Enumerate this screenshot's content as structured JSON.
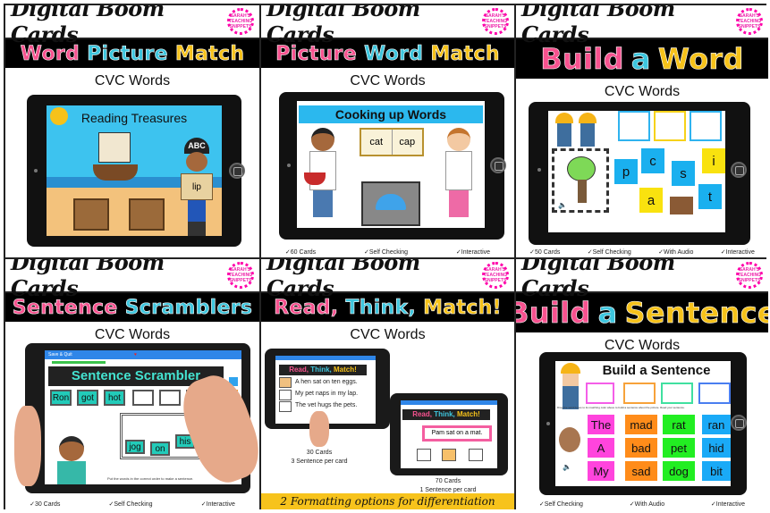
{
  "header_title": "Digital Boom Cards",
  "logo_text": "SARAH'S TEACHING SNIPPETS",
  "panels": [
    {
      "title_words": [
        {
          "text": "Word",
          "color": "pink"
        },
        {
          "text": "Picture",
          "color": "cyan"
        },
        {
          "text": "Match",
          "color": "yellow"
        }
      ],
      "subtitle": "CVC Words",
      "scene_title": "Reading Treasures",
      "scroll_word": "lip",
      "pirate_hat_text": "ABC",
      "features": []
    },
    {
      "title_words": [
        {
          "text": "Picture",
          "color": "pink"
        },
        {
          "text": "Word",
          "color": "cyan"
        },
        {
          "text": "Match",
          "color": "yellow"
        }
      ],
      "subtitle": "CVC Words",
      "scene_title": "Cooking up Words",
      "book_words": [
        "cat",
        "cap"
      ],
      "features": [
        "60 Cards",
        "Self Checking",
        "Interactive"
      ]
    },
    {
      "title_words": [
        {
          "text": "Build",
          "color": "pink"
        },
        {
          "text": "a",
          "color": "cyan"
        },
        {
          "text": "Word",
          "color": "yellow"
        }
      ],
      "subtitle": "CVC Words",
      "letter_tiles": [
        {
          "letter": "p",
          "color": "#1ab0ef"
        },
        {
          "letter": "c",
          "color": "#1ab0ef"
        },
        {
          "letter": "s",
          "color": "#1ab0ef"
        },
        {
          "letter": "i",
          "color": "#f9e20f"
        },
        {
          "letter": "a",
          "color": "#f9e20f"
        },
        {
          "letter": "t",
          "color": "#1ab0ef"
        }
      ],
      "features": [
        "50 Cards",
        "Self Checking",
        "With Audio",
        "Interactive"
      ]
    },
    {
      "title_words": [
        {
          "text": "Sentence",
          "color": "pink"
        },
        {
          "text": "Scramblers",
          "color": "cyan"
        }
      ],
      "subtitle": "CVC Words",
      "app_bar_label": "Save & Quit",
      "scene_title": "Sentence Scrambler",
      "top_words": [
        "Ron",
        "got",
        "hot"
      ],
      "answer_words": [
        "jog",
        "on",
        "his"
      ],
      "instruction": "Put the words in the correct order to make a sentence.",
      "features": [
        "30 Cards",
        "Self Checking",
        "Interactive"
      ]
    },
    {
      "title_words": [
        {
          "text": "Read,",
          "color": "pink"
        },
        {
          "text": "Think,",
          "color": "cyan"
        },
        {
          "text": "Match!",
          "color": "yellow"
        }
      ],
      "subtitle": "CVC Words",
      "mini_title_words": [
        {
          "text": "Read,",
          "color": "pink"
        },
        {
          "text": "Think,",
          "color": "cyan"
        },
        {
          "text": "Match!",
          "color": "yellow"
        }
      ],
      "left_sentences": [
        "A hen sat on ten eggs.",
        "My pet naps in my lap.",
        "The vet hugs the pets."
      ],
      "right_sentence": "Pam sat on a mat.",
      "left_caption": [
        "30 Cards",
        "3 Sentence per card"
      ],
      "right_caption": [
        "70 Cards",
        "1 Sentence per card"
      ],
      "footer": "2 Formatting options for differentiation"
    },
    {
      "title_words": [
        {
          "text": "Build",
          "color": "pink"
        },
        {
          "text": "a",
          "color": "cyan"
        },
        {
          "text": "Sentence",
          "color": "yellow"
        }
      ],
      "subtitle": "CVC Words",
      "scene_title": "Build a Sentence",
      "instruction": "Drag the word boxes to its matching color above to build a sentence about the picture. Read your sentence.",
      "slot_colors": [
        "#f45ee8",
        "#f7a23a",
        "#40e0a0",
        "#4a7ef0"
      ],
      "columns": [
        {
          "color": "#ff44dd",
          "words": [
            "The",
            "A",
            "My"
          ]
        },
        {
          "color": "#ff8c1a",
          "words": [
            "mad",
            "bad",
            "sad"
          ]
        },
        {
          "color": "#22ee22",
          "words": [
            "rat",
            "pet",
            "dog"
          ]
        },
        {
          "color": "#1aaaf7",
          "words": [
            "ran",
            "hid",
            "bit"
          ]
        }
      ],
      "features": [
        "Self Checking",
        "With Audio",
        "Interactive"
      ]
    }
  ]
}
